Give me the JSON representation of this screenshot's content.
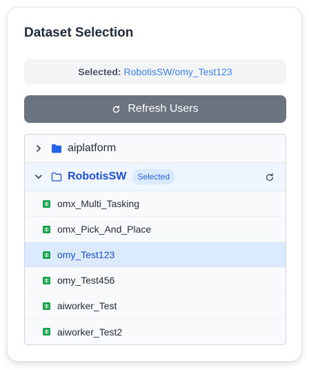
{
  "panel": {
    "title": "Dataset Selection",
    "selected_label": "Selected:",
    "selected_value": "RobotisSW/omy_Test123",
    "refresh_button_label": "Refresh Users"
  },
  "tree": {
    "orgs": [
      {
        "name": "aiplatform",
        "expanded": false,
        "icon": "folder-solid-icon"
      },
      {
        "name": "RobotisSW",
        "expanded": true,
        "badge": "Selected",
        "icon": "folder-outline-icon"
      }
    ],
    "datasets": [
      {
        "name": "omx_Multi_Tasking",
        "selected": false
      },
      {
        "name": "omx_Pick_And_Place",
        "selected": false
      },
      {
        "name": "omy_Test123",
        "selected": true
      },
      {
        "name": "omy_Test456",
        "selected": false
      },
      {
        "name": "aiworker_Test",
        "selected": false
      },
      {
        "name": "aiworker_Test2",
        "selected": false
      }
    ]
  },
  "colors": {
    "accent": "#2563eb",
    "button_bg": "#6b7280",
    "dataset_icon": "#16a34a",
    "selected_row_bg": "#dbeafe"
  }
}
